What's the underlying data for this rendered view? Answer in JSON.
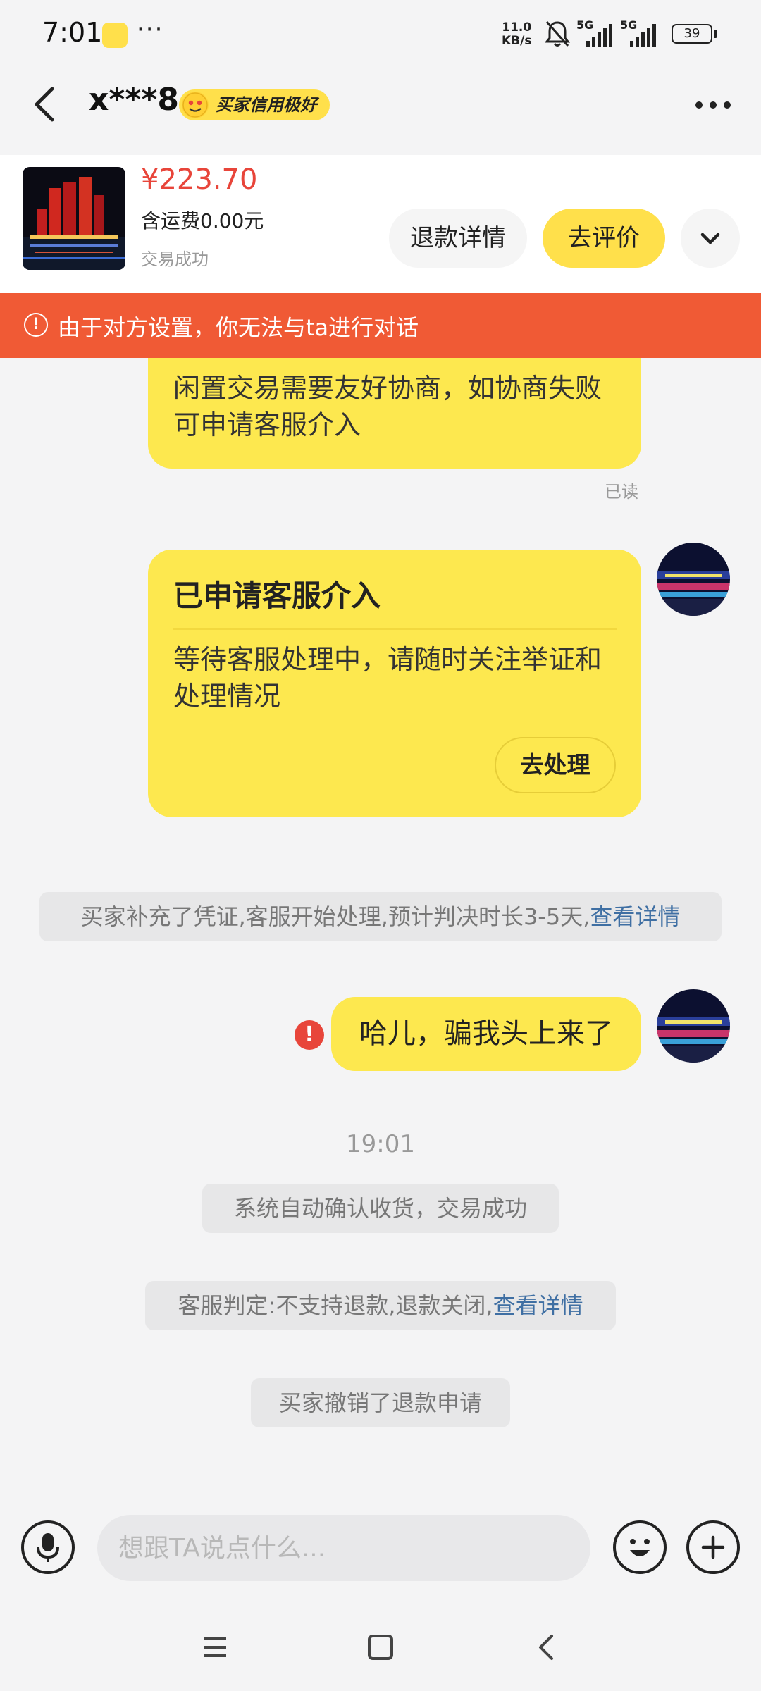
{
  "status_bar": {
    "time": "7:01",
    "more": "···",
    "net_speed_value": "11.0",
    "net_speed_unit": "KB/s",
    "sim1": "5G",
    "sim2": "5G",
    "battery": "39"
  },
  "header": {
    "username": "x***8",
    "credit_badge": "买家信用极好"
  },
  "order": {
    "price": "¥223.70",
    "shipping": "含运费0.00元",
    "status": "交易成功",
    "refund_details_label": "退款详情",
    "review_label": "去评价"
  },
  "banner": {
    "icon": "!",
    "text": "由于对方设置，你无法与ta进行对话"
  },
  "messages": {
    "top_bubble_text": "闲置交易需要友好协商，如协商失败可申请客服介入",
    "read_mark": "已读",
    "card_title": "已申请客服介入",
    "card_body": "等待客服处理中，请随时关注举证和处理情况",
    "card_button": "去处理",
    "system1_text": "买家补充了凭证,客服开始处理,预计判决时长3-5天,",
    "system1_link": "查看详情",
    "user_message": "哈儿，骗我头上来了",
    "error_icon": "!",
    "timestamp": "19:01",
    "system2_text": "系统自动确认收货，交易成功",
    "system3_text": "客服判定:不支持退款,退款关闭,",
    "system3_link": "查看详情",
    "system4_text": "买家撤销了退款申请"
  },
  "input": {
    "placeholder": "想跟TA说点什么..."
  },
  "colors": {
    "accent_yellow": "#fde84f",
    "banner_red": "#f05a35",
    "price_red": "#e8453a",
    "link_blue": "#3f6fa3"
  }
}
